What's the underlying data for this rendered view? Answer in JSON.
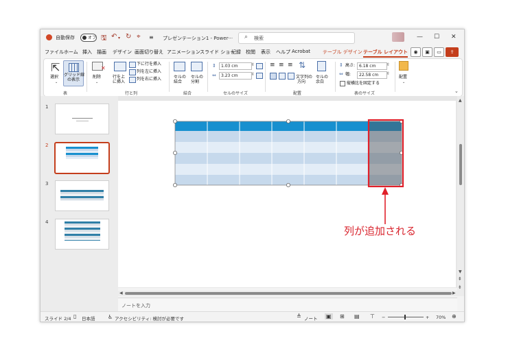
{
  "window": {
    "autosave_label": "自動保存",
    "autosave_state": "オフ",
    "document_title": "プレゼンテーション1 - Power···",
    "search_placeholder": "検索",
    "minimize_icon": "—",
    "maximize_icon": "☐",
    "close_icon": "✕"
  },
  "menu": {
    "tabs": [
      "ファイル",
      "ホーム",
      "挿入",
      "描画",
      "デザイン",
      "画面切り替え",
      "アニメーション",
      "スライド ショー",
      "記録",
      "校閲",
      "表示",
      "ヘルプ",
      "Acrobat"
    ],
    "table_design": "テーブル デザイン",
    "table_layout": "テーブル レイアウト"
  },
  "ribbon": {
    "select_label": "選択",
    "gridlines_label": [
      "グリッド線",
      "の表示"
    ],
    "group_table": "表",
    "delete_label": "削除",
    "insert_above_label": [
      "行を上",
      "に挿入"
    ],
    "insert_below": "下に行を挿入",
    "insert_left": "列を左に挿入",
    "insert_right": "列を右に挿入",
    "group_rows_cols": "行と列",
    "merge_cells_label": [
      "セルの",
      "結合"
    ],
    "split_cells_label": [
      "セルの",
      "分割"
    ],
    "group_merge": "結合",
    "cell_height": "1.03 cm",
    "cell_width": "3.23 cm",
    "group_cell_size": "セルのサイズ",
    "text_direction_label": [
      "文字列の",
      "方向"
    ],
    "cell_margins_label": [
      "セルの",
      "余白"
    ],
    "group_alignment": "配置",
    "height_label": "高さ:",
    "table_height": "6.18 cm",
    "width_label": "幅:",
    "table_width": "22.58 cm",
    "lock_aspect_label": "縦横比を固定する",
    "group_table_size": "表のサイズ",
    "arrange_label": "配置"
  },
  "slides": {
    "numbers": [
      "1",
      "2",
      "3",
      "4"
    ]
  },
  "notes": {
    "placeholder": "ノートを入力"
  },
  "status": {
    "slide_indicator": "スライド 2/4",
    "language": "日本語",
    "accessibility": "アクセシビリティ: 検討が必要です",
    "notes_button": "ノート",
    "zoom": "70%"
  },
  "annotation": {
    "text": "列が追加される"
  },
  "colors": {
    "accent": "#c43e1c",
    "table_header": "#1790cf",
    "table_band_dark": "#c6d9ec",
    "table_band_light": "#e3edf7",
    "highlight_red": "#e0202a"
  }
}
